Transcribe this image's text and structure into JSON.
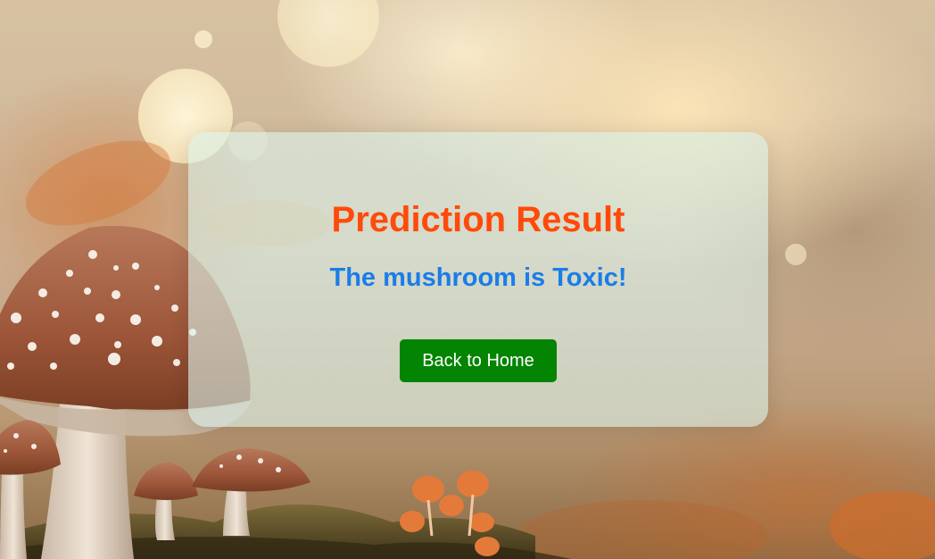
{
  "card": {
    "title": "Prediction Result",
    "result": "The mushroom is Toxic!",
    "button_label": "Back to Home"
  },
  "colors": {
    "title": "#ff4a0a",
    "result": "#1a7de8",
    "button": "#038403",
    "card_bg": "rgba(218,240,232,0.62)"
  }
}
